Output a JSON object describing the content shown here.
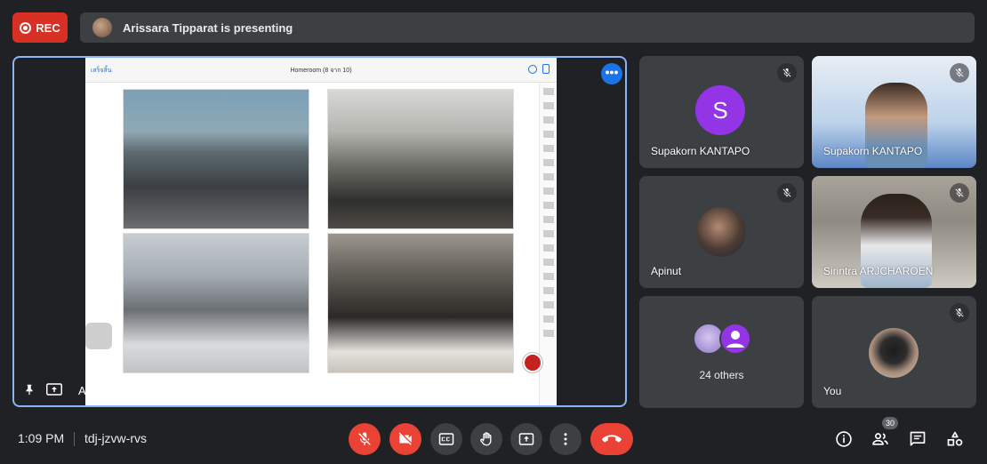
{
  "recording": {
    "label": "REC"
  },
  "presenting_banner": {
    "text": "Arissara Tipparat is presenting"
  },
  "presentation": {
    "presenter_name": "Arissara Tipparat",
    "slide_back_label": "เสร็จสิ้น",
    "slide_title": "Homeroom (8 จาก 10)",
    "more_options_label": "•••"
  },
  "participants": [
    {
      "name": "Supakorn KANTAPO",
      "initial": "S",
      "avatar_color": "#9334e6",
      "muted": true
    },
    {
      "name": "Supakorn KANTAPO",
      "muted": true
    },
    {
      "name": "Apinut",
      "muted": true
    },
    {
      "name": "Sirintra ARJCHAROEN",
      "muted": true
    },
    {
      "name": "24 others"
    },
    {
      "name": "You",
      "muted": true
    }
  ],
  "meeting": {
    "time": "1:09 PM",
    "code": "tdj-jzvw-rvs"
  },
  "people_count": "30",
  "colors": {
    "accent": "#8ab4f8",
    "danger": "#ea4335",
    "rec": "#d93025",
    "tile": "#3c4043",
    "background": "#202124"
  }
}
